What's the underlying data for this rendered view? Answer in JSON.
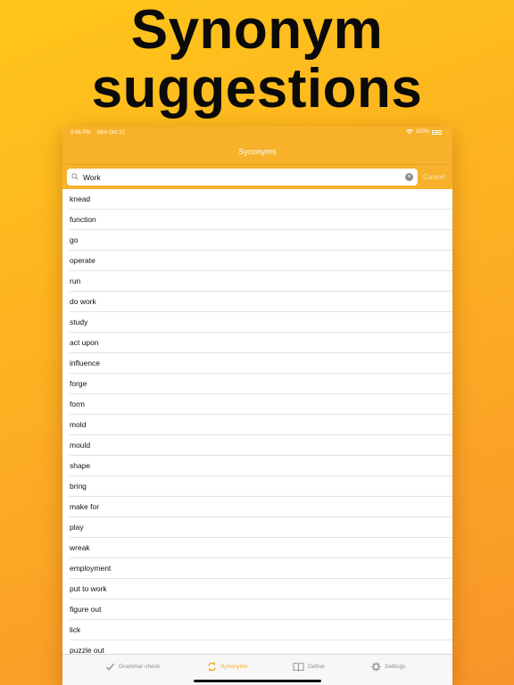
{
  "headline": {
    "line1": "Synonym",
    "line2": "suggestions"
  },
  "status_bar": {
    "time": "5:58 PM",
    "date": "Mon Oct 21",
    "battery": "100%"
  },
  "nav": {
    "title": "Synonyms"
  },
  "search": {
    "value": "Work",
    "cancel_label": "Cancel"
  },
  "results": [
    "knead",
    "function",
    "go",
    "operate",
    "run",
    "do work",
    "study",
    "act upon",
    "influence",
    "forge",
    "form",
    "mold",
    "mould",
    "shape",
    "bring",
    "make for",
    "play",
    "wreak",
    "employment",
    "put to work",
    "figure out",
    "lick",
    "puzzle out"
  ],
  "tabs": [
    {
      "label": "Grammar check",
      "icon": "checkmark-icon"
    },
    {
      "label": "Synonyms",
      "icon": "synonyms-icon",
      "active": true
    },
    {
      "label": "Define",
      "icon": "book-icon"
    },
    {
      "label": "Settings",
      "icon": "gear-icon"
    }
  ],
  "colors": {
    "accent": "#F6A823",
    "background": "#FDB022"
  }
}
